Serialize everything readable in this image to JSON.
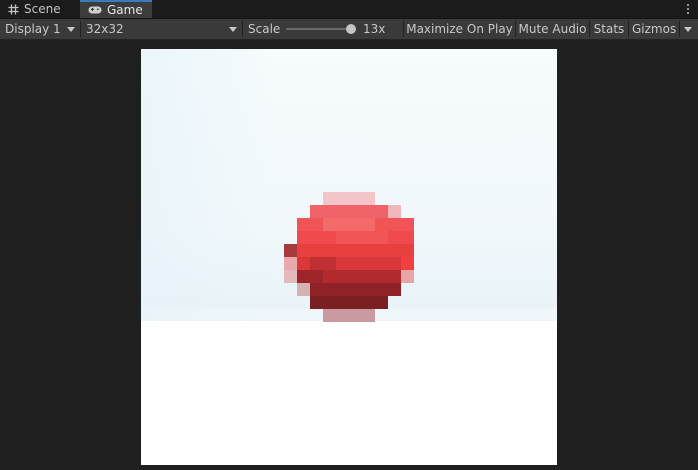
{
  "tabs": {
    "scene": {
      "label": "Scene",
      "icon": "grid-icon"
    },
    "game": {
      "label": "Game",
      "icon": "gamepad-icon",
      "active": true
    }
  },
  "toolbar": {
    "display": "Display 1",
    "resolution": "32x32",
    "scale_label": "Scale",
    "scale_value": "13x",
    "scale_level": 13,
    "maximize_label": "Maximize On Play",
    "mute_label": "Mute Audio",
    "stats_label": "Stats",
    "gizmos_label": "Gizmos"
  },
  "colors": {
    "accent_tab": "#3a79bb",
    "ball_red": "#f04a4a",
    "ball_dark": "#7a1f22",
    "ball_pink": "#e8a8ac"
  }
}
